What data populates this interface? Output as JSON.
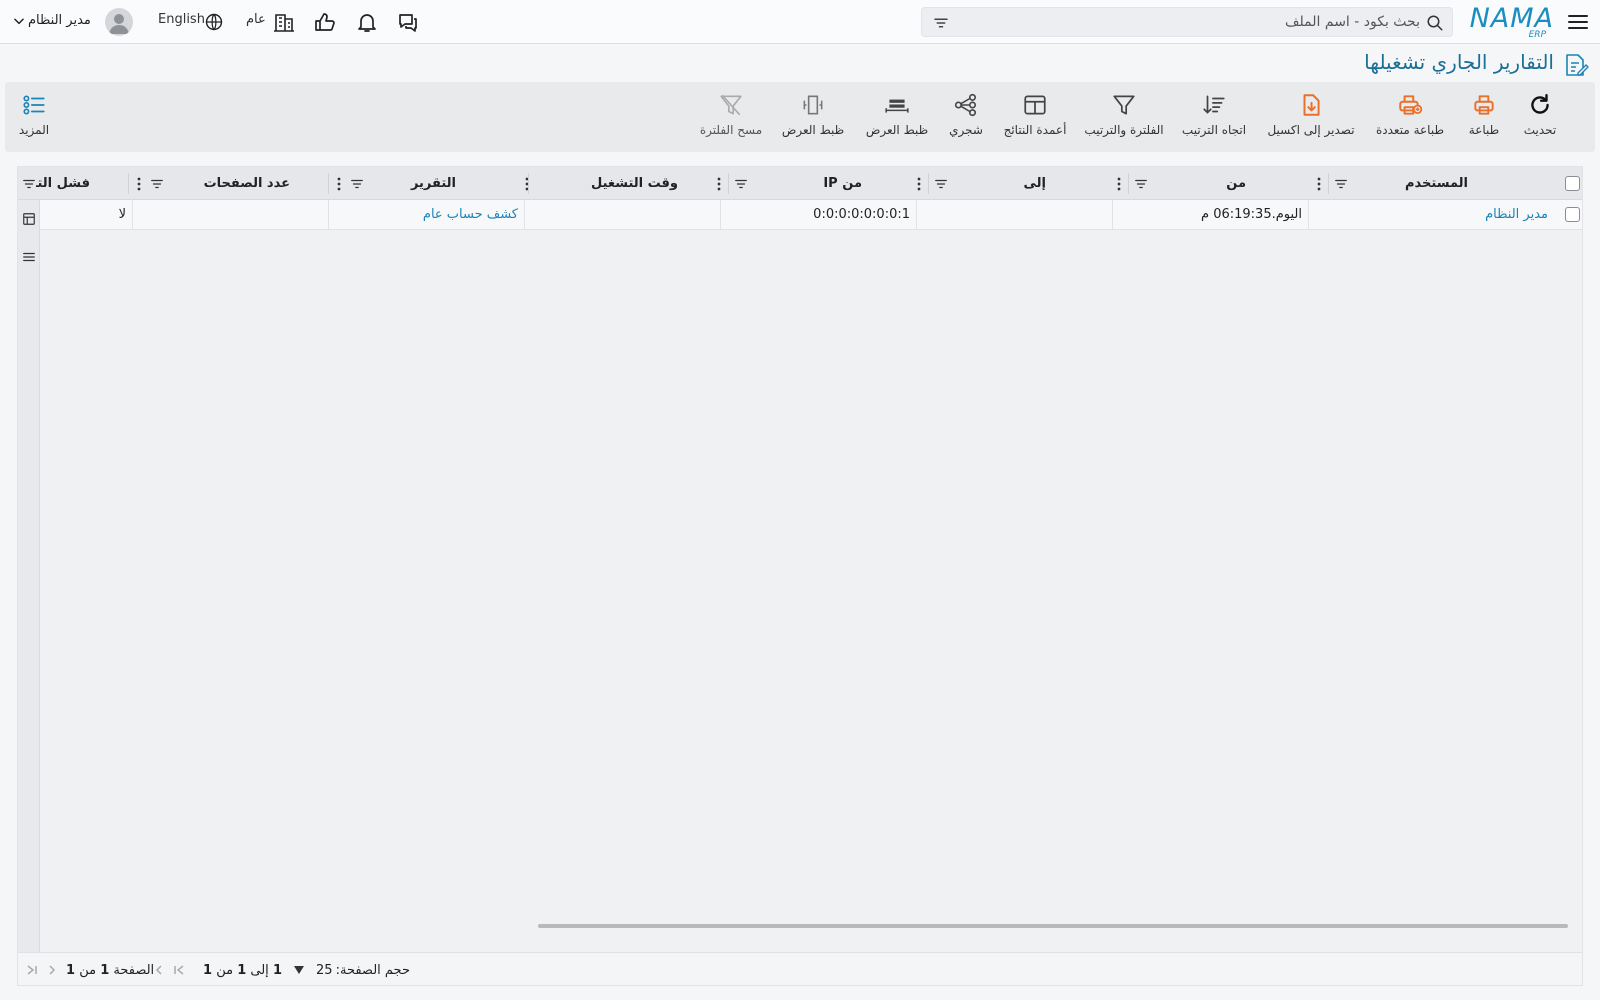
{
  "app": {
    "logo_text": "NAMA",
    "logo_sub": "ERP"
  },
  "header": {
    "search_placeholder": "بحث بكود - اسم الملف",
    "branch": "عام",
    "language": "English",
    "user_name": "مدير النظام"
  },
  "page": {
    "title": "التقارير الجاري تشغيلها"
  },
  "toolbar": {
    "refresh": "تحديث",
    "print": "طباعة",
    "multi_print": "طباعة متعددة",
    "export_excel": "تصدير إلى اكسيل",
    "sort_direction": "اتجاه الترتيب",
    "filter_sort": "الفلترة والترتيب",
    "result_columns": "أعمدة النتائج",
    "tree": "شجري",
    "fit_view_1": "ظبط العرض",
    "fit_view_2": "ظبط العرض",
    "clear_filter": "مسح الفلترة",
    "more": "المزيد"
  },
  "table": {
    "columns": {
      "user": "المستخدم",
      "from": "من",
      "to": "إلى",
      "from_ip": "من IP",
      "run_time": "وقت التشغيل",
      "report": "التقرير",
      "pages": "عدد الصفحات",
      "failed": "فشل التنـ"
    },
    "rows": [
      {
        "user": "مدير النظام",
        "from": "اليوم.06:19:35 م",
        "to": "",
        "from_ip": "0:0:0:0:0:0:0:1",
        "run_time": "",
        "report": "كشف حساب عام",
        "pages": "",
        "failed": "لا"
      }
    ]
  },
  "pager": {
    "page_size_label": "حجم الصفحة:",
    "page_size": "25",
    "range_prefix": "1",
    "range_to": "إلى",
    "range_end": "1",
    "range_of": "من",
    "range_total": "1",
    "page_label": "الصفحة",
    "page_current": "1",
    "page_of": "من",
    "page_total": "1"
  },
  "colors": {
    "accent": "#1a8ec0",
    "orange": "#e8702a",
    "link": "#1a84b8"
  }
}
